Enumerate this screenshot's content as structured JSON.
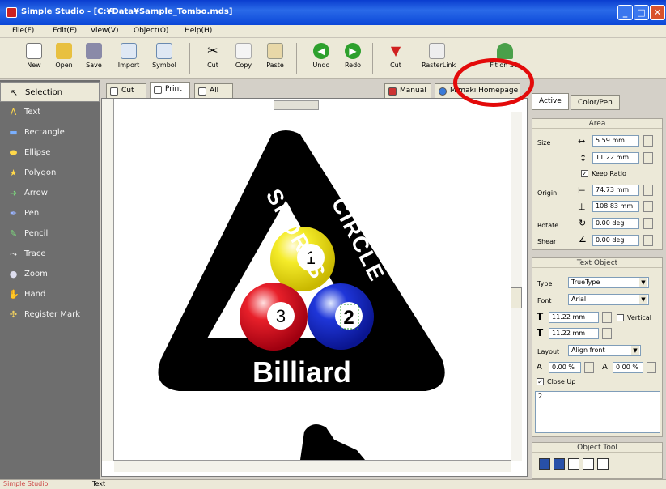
{
  "window": {
    "title": "Simple Studio - [C:¥Data¥Sample_Tombo.mds]",
    "controls": {
      "minimize": "_",
      "maximize": "□",
      "close": "✕"
    }
  },
  "menu": [
    "File(F)",
    "Edit(E)",
    "View(V)",
    "Object(O)",
    "Help(H)"
  ],
  "toolbar": [
    {
      "label": "New",
      "icon": "new-document-icon"
    },
    {
      "label": "Open",
      "icon": "open-folder-icon"
    },
    {
      "label": "Save",
      "icon": "save-disk-icon"
    },
    {
      "label": "Import",
      "icon": "import-icon"
    },
    {
      "label": "Symbol",
      "icon": "symbol-icon"
    },
    {
      "label": "Cut",
      "icon": "scissors-icon"
    },
    {
      "label": "Copy",
      "icon": "copy-icon"
    },
    {
      "label": "Paste",
      "icon": "paste-icon"
    },
    {
      "label": "Undo",
      "icon": "undo-icon"
    },
    {
      "label": "Redo",
      "icon": "redo-icon"
    },
    {
      "label": "Cut",
      "icon": "plotter-cut-icon"
    },
    {
      "label": "RasterLink",
      "icon": "rasterlink-icon"
    },
    {
      "label": "Fit on Scr",
      "icon": "fit-on-screen-icon"
    }
  ],
  "palette": [
    {
      "label": "Selection",
      "icon": "arrow-cursor-icon",
      "glyph": "↖"
    },
    {
      "label": "Text",
      "icon": "text-icon",
      "glyph": "A"
    },
    {
      "label": "Rectangle",
      "icon": "rectangle-icon",
      "glyph": "▬"
    },
    {
      "label": "Ellipse",
      "icon": "ellipse-icon",
      "glyph": "⬬"
    },
    {
      "label": "Polygon",
      "icon": "star-icon",
      "glyph": "★"
    },
    {
      "label": "Arrow",
      "icon": "arrow-icon",
      "glyph": "➜"
    },
    {
      "label": "Pen",
      "icon": "pen-icon",
      "glyph": "✒"
    },
    {
      "label": "Pencil",
      "icon": "pencil-icon",
      "glyph": "✎"
    },
    {
      "label": "Trace",
      "icon": "trace-icon",
      "glyph": "⤳"
    },
    {
      "label": "Zoom",
      "icon": "magnifier-icon",
      "glyph": "●"
    },
    {
      "label": "Hand",
      "icon": "hand-icon",
      "glyph": "✋"
    },
    {
      "label": "Register Mark",
      "icon": "register-mark-icon",
      "glyph": "✣"
    }
  ],
  "doc_tabs": [
    {
      "label": "Cut",
      "active": false
    },
    {
      "label": "Print",
      "active": true
    },
    {
      "label": "All",
      "active": false
    },
    {
      "label": "Manual",
      "active": false
    },
    {
      "label": "Mimaki Homepage",
      "active": false
    }
  ],
  "artwork": {
    "word_left": "SPORTS",
    "word_right": "CIRCLE",
    "word_bottom": "Billiard",
    "ball_1": "1",
    "ball_2": "2",
    "ball_3": "3",
    "colors": {
      "ball_1": "#f5ec2a",
      "ball_2": "#1f36d9",
      "ball_3": "#e8202a",
      "triangle": "#000000"
    }
  },
  "right_tabs": [
    "Active",
    "Color/Pen"
  ],
  "area": {
    "title": "Area",
    "size_label": "Size",
    "width": "5.59 mm",
    "height": "11.22 mm",
    "keep_ratio": "Keep Ratio",
    "origin_label": "Origin",
    "origin_x": "74.73 mm",
    "origin_y": "108.83 mm",
    "rotate_label": "Rotate",
    "rotate": "0.00 deg",
    "shear_label": "Shear",
    "shear": "0.00 deg"
  },
  "text_object": {
    "title": "Text Object",
    "type_label": "Type",
    "type": "TrueType",
    "font_label": "Font",
    "font": "Arial",
    "size1": "11.22 mm",
    "vertical": "Vertical",
    "size2": "11.22 mm",
    "layout_label": "Layout",
    "layout": "Align front",
    "spacing1": "0.00 %",
    "spacing2": "0.00 %",
    "close_up": "Close Up",
    "text_content": "2"
  },
  "object_tool": {
    "title": "Object Tool"
  },
  "status": {
    "mode": "Text",
    "app": "Simple Studio"
  }
}
